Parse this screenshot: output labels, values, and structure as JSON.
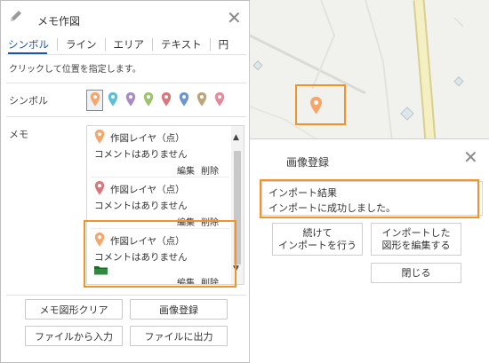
{
  "memo_panel": {
    "title": "メモ作図",
    "tabs": [
      "シンボル",
      "ライン",
      "エリア",
      "テキスト",
      "円"
    ],
    "instruction": "クリックして位置を指定します。",
    "symbol_label": "シンボル",
    "memo_label": "メモ",
    "symbol_colors": [
      "#f6a56b",
      "#5cbfd8",
      "#a98cc7",
      "#9dc46c",
      "#d9777d",
      "#6b96d0",
      "#bda57a",
      "#e48a9a"
    ],
    "memos": [
      {
        "name": "作図レイヤ（点）",
        "comment": "コメントはありません",
        "edit": "編集",
        "delete": "削除",
        "pin_color": "#f6a56b"
      },
      {
        "name": "作図レイヤ（点）",
        "comment": "コメントはありません",
        "edit": "編集",
        "delete": "削除",
        "pin_color": "#d9777d"
      },
      {
        "name": "作図レイヤ（点）",
        "comment": "コメントはありません",
        "edit": "編集",
        "delete": "削除",
        "pin_color": "#f6a56b",
        "has_folder": true
      }
    ],
    "buttons": {
      "clear": "メモ図形クリア",
      "image_register": "画像登録",
      "import_file": "ファイルから入力",
      "export_file": "ファイルに出力"
    }
  },
  "dialog": {
    "title": "画像登録",
    "result_title": "インポート結果",
    "result_message": "インポートに成功しました。",
    "continue_import": [
      "続けて",
      "インポートを行う"
    ],
    "edit_imported": [
      "インポートした",
      "図形を編集する"
    ],
    "close": "閉じる"
  },
  "icons": {
    "pencil": "pencil-icon",
    "close": "close-icon",
    "map_pin": "map-pin-icon",
    "folder": "folder-icon"
  },
  "colors": {
    "accent": "#1a57b5",
    "highlight": "#f0932b",
    "pin_orange": "#f6a56b",
    "road_fill": "#f5efc4",
    "road_border": "#d9cf91"
  }
}
